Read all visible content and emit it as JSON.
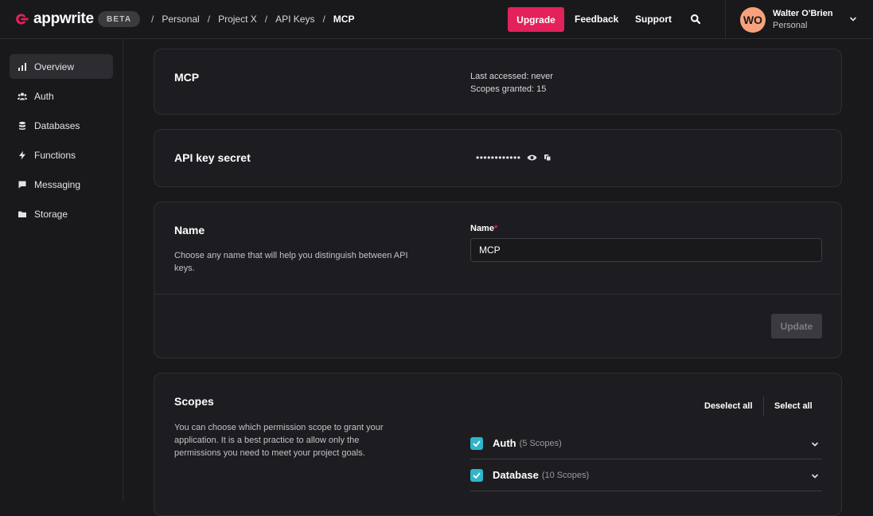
{
  "header": {
    "logo_text": "appwrite",
    "beta_label": "BETA",
    "breadcrumb": [
      "Personal",
      "Project X",
      "API Keys",
      "MCP"
    ],
    "breadcrumb_sep": "/",
    "upgrade_label": "Upgrade",
    "feedback_label": "Feedback",
    "support_label": "Support",
    "user": {
      "initials": "WO",
      "name": "Walter O'Brien",
      "org": "Personal"
    },
    "accent_color": "#e3215a"
  },
  "sidebar": {
    "items": [
      {
        "label": "Overview",
        "icon": "bar-chart-icon",
        "active": true
      },
      {
        "label": "Auth",
        "icon": "users-icon",
        "active": false
      },
      {
        "label": "Databases",
        "icon": "database-icon",
        "active": false
      },
      {
        "label": "Functions",
        "icon": "lightning-icon",
        "active": false
      },
      {
        "label": "Messaging",
        "icon": "chat-icon",
        "active": false
      },
      {
        "label": "Storage",
        "icon": "folder-icon",
        "active": false
      }
    ]
  },
  "key_info": {
    "title": "MCP",
    "last_accessed": "Last accessed: never",
    "scopes_granted": "Scopes granted: 15"
  },
  "secret": {
    "title": "API key secret",
    "masked_value": "••••••••••••"
  },
  "name_section": {
    "title": "Name",
    "description": "Choose any name that will help you distinguish between API keys.",
    "field_label": "Name",
    "required_mark": "*",
    "field_value": "MCP",
    "update_label": "Update"
  },
  "scopes_section": {
    "title": "Scopes",
    "description": "You can choose which permission scope to grant your application. It is a best practice to allow only the permissions you need to meet your project goals.",
    "deselect_all_label": "Deselect all",
    "select_all_label": "Select all",
    "groups": [
      {
        "label": "Auth",
        "count": "(5 Scopes)",
        "checked": true
      },
      {
        "label": "Database",
        "count": "(10 Scopes)",
        "checked": true
      }
    ],
    "checkbox_color": "#2fb5c9"
  }
}
